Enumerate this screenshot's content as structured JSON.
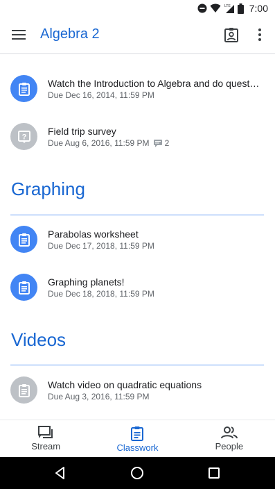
{
  "status_bar": {
    "time": "7:00",
    "network_label": "LTE"
  },
  "app_bar": {
    "title": "Algebra 2"
  },
  "items": [
    {
      "title": "Watch the Introduction to Algebra and do quest…",
      "due": "Due Dec 16, 2014, 11:59 PM",
      "icon": "assignment-icon",
      "color": "#4285f4"
    },
    {
      "title": "Field trip survey",
      "due": "Due Aug 6, 2016, 11:59 PM",
      "comments": "2",
      "icon": "question-icon",
      "color": "#bdc1c6"
    },
    {
      "title": "Parabolas worksheet",
      "due": "Due Dec 17, 2018, 11:59 PM",
      "icon": "assignment-icon",
      "color": "#4285f4"
    },
    {
      "title": "Graphing planets!",
      "due": "Due Dec 18, 2018, 11:59 PM",
      "icon": "assignment-icon",
      "color": "#4285f4"
    },
    {
      "title": "Watch video on quadratic equations",
      "due": "Due Aug 3, 2016, 11:59 PM",
      "icon": "assignment-icon",
      "color": "#bdc1c6"
    }
  ],
  "sections": [
    {
      "title": "Graphing"
    },
    {
      "title": "Videos"
    }
  ],
  "bottom_nav": [
    {
      "label": "Stream",
      "icon": "stream-icon"
    },
    {
      "label": "Classwork",
      "icon": "classwork-icon",
      "active": true
    },
    {
      "label": "People",
      "icon": "people-icon"
    }
  ],
  "colors": {
    "accent": "#1967d2",
    "icon_blue": "#4285f4",
    "icon_gray": "#bdc1c6",
    "divider": "#669df6"
  }
}
